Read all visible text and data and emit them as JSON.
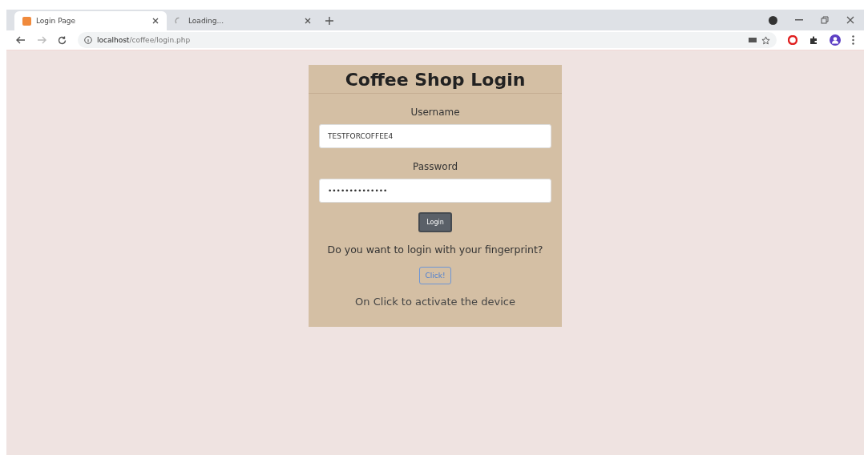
{
  "browser": {
    "tabs": [
      {
        "title": "Login Page",
        "selected": true,
        "loading": false
      },
      {
        "title": "Loading...",
        "selected": false,
        "loading": true
      }
    ],
    "address": {
      "host": "localhost",
      "path": "/coffee/login.php"
    }
  },
  "login": {
    "title": "Coffee Shop Login",
    "username_label": "Username",
    "username_value": "TESTFORCOFFEE4",
    "password_label": "Password",
    "password_value": "••••••••••••••",
    "login_button": "Login",
    "fingerprint_prompt": "Do you want to login with your fingerprint?",
    "click_button": "Click!",
    "hint": "On Click to activate the device"
  }
}
